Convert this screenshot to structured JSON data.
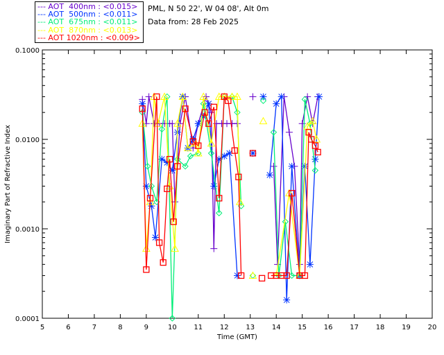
{
  "header": {
    "site": "PML, N 50 22', W 04 08', Alt 0m",
    "date": "Data from: 28 Feb 2025"
  },
  "legend": [
    {
      "label": "AOT  400nm : <0.015>",
      "color": "#6600cc"
    },
    {
      "label": "AOT  500nm : <0.011>",
      "color": "#0033ff"
    },
    {
      "label": "AOT  675nm : <0.011>",
      "color": "#00ee77"
    },
    {
      "label": "AOT  870nm : <0.013>",
      "color": "#ffff00"
    },
    {
      "label": "AOT 1020nm : <0.009>",
      "color": "#ff0000"
    }
  ],
  "chart_data": {
    "type": "line",
    "xlabel": "Time (GMT)",
    "ylabel": "Imaginary Part of Refractive Index",
    "xlim": [
      5,
      20
    ],
    "ylim": [
      0.0001,
      0.1
    ],
    "yscale": "log",
    "xticks": [
      "5",
      "6",
      "7",
      "8",
      "9",
      "10",
      "11",
      "12",
      "13",
      "14",
      "15",
      "16",
      "17",
      "18",
      "19",
      "20"
    ],
    "yticks": [
      "0.0001",
      "0.0010",
      "0.0100",
      "0.1000"
    ],
    "grid": false,
    "legend_position": "top-left",
    "series": [
      {
        "name": "AOT  400nm : <0.015>",
        "color": "#6600cc",
        "marker": "plus",
        "x": [
          8.85,
          9.0,
          9.1,
          9.3,
          9.5,
          9.7,
          9.9,
          10.0,
          10.1,
          10.3,
          10.5,
          10.8,
          11.0,
          11.3,
          11.5,
          11.6,
          11.7,
          11.9,
          12.1,
          12.3,
          12.5,
          null,
          13.1,
          null,
          13.9,
          14.05,
          14.3,
          14.5,
          14.7,
          14.9,
          15.0,
          15.2,
          15.4,
          15.6
        ],
        "y": [
          0.028,
          0.015,
          0.03,
          0.015,
          0.015,
          0.015,
          0.015,
          0.015,
          0.002,
          0.015,
          0.03,
          0.008,
          0.015,
          0.03,
          0.02,
          0.0006,
          0.015,
          0.015,
          0.015,
          0.015,
          0.015,
          null,
          0.03,
          null,
          0.005,
          0.0004,
          0.03,
          0.012,
          0.005,
          0.0004,
          0.015,
          0.03,
          0.015,
          0.03
        ]
      },
      {
        "name": "AOT  500nm : <0.011>",
        "color": "#0033ff",
        "marker": "asterisk",
        "x": [
          8.85,
          9.0,
          9.2,
          9.35,
          9.6,
          9.8,
          10.0,
          10.2,
          10.4,
          10.6,
          10.8,
          11.0,
          11.2,
          11.4,
          11.6,
          11.8,
          12.0,
          12.2,
          12.5,
          null,
          13.1,
          null,
          13.5,
          null,
          13.75,
          14.0,
          14.2,
          14.4,
          14.6,
          14.9,
          15.1,
          15.3,
          15.5,
          15.65
        ],
        "y": [
          0.025,
          0.003,
          0.0018,
          0.0008,
          0.006,
          0.0055,
          0.0045,
          0.012,
          0.03,
          0.008,
          0.01,
          0.015,
          0.018,
          0.025,
          0.003,
          0.006,
          0.0065,
          0.007,
          0.0003,
          null,
          0.007,
          null,
          0.03,
          null,
          0.004,
          0.025,
          0.03,
          0.00016,
          0.005,
          0.0003,
          0.005,
          0.0004,
          0.006,
          0.03
        ]
      },
      {
        "name": "AOT  675nm : <0.011>",
        "color": "#00ee77",
        "marker": "diamond",
        "x": [
          8.85,
          9.05,
          9.2,
          9.4,
          9.6,
          9.8,
          10.0,
          10.2,
          10.5,
          10.7,
          11.0,
          11.2,
          11.5,
          11.8,
          12.0,
          12.3,
          12.5,
          12.65,
          null,
          13.1,
          null,
          13.5,
          null,
          13.9,
          14.1,
          14.35,
          14.6,
          14.9,
          15.1,
          15.3,
          15.5
        ],
        "y": [
          0.02,
          0.005,
          0.003,
          0.002,
          0.013,
          0.03,
          0.0001,
          0.006,
          0.005,
          0.0065,
          0.007,
          0.025,
          0.007,
          0.0015,
          0.03,
          0.03,
          0.02,
          0.0018,
          null,
          0.0003,
          null,
          0.027,
          null,
          0.012,
          0.0003,
          0.0012,
          0.0003,
          0.0003,
          0.028,
          0.015,
          0.0045
        ]
      },
      {
        "name": "AOT  870nm : <0.013>",
        "color": "#ffff00",
        "marker": "triangle",
        "x": [
          8.85,
          9.0,
          9.15,
          9.3,
          9.45,
          9.7,
          9.9,
          10.1,
          10.2,
          10.4,
          10.6,
          10.9,
          11.0,
          11.2,
          11.5,
          11.8,
          12.0,
          12.3,
          12.5,
          12.6,
          null,
          13.1,
          null,
          13.5,
          null,
          14.0,
          14.5,
          14.9,
          15.2,
          15.4,
          15.55
        ],
        "y": [
          0.015,
          0.0006,
          0.002,
          0.03,
          0.015,
          0.03,
          0.003,
          0.0006,
          0.015,
          0.03,
          0.008,
          0.009,
          0.007,
          0.03,
          0.009,
          0.03,
          0.03,
          0.03,
          0.03,
          0.002,
          null,
          0.0003,
          null,
          0.016,
          null,
          0.0003,
          0.0025,
          0.0003,
          0.014,
          0.016,
          0.01
        ]
      },
      {
        "name": "AOT 1020nm : <0.009>",
        "color": "#ff0000",
        "marker": "square",
        "x": [
          8.85,
          9.0,
          9.15,
          9.4,
          9.5,
          9.65,
          9.8,
          9.9,
          10.05,
          10.2,
          10.5,
          10.8,
          11.0,
          11.25,
          11.4,
          11.6,
          11.8,
          12.0,
          12.15,
          12.4,
          12.55,
          12.65,
          null,
          13.1,
          null,
          13.45,
          null,
          13.8,
          14.0,
          14.2,
          14.4,
          14.6,
          14.9,
          15.1,
          15.25,
          15.35,
          15.5,
          15.6
        ],
        "y": [
          0.022,
          0.00035,
          0.0022,
          0.03,
          0.0007,
          0.00042,
          0.0028,
          0.006,
          0.0012,
          0.005,
          0.022,
          0.0095,
          0.0085,
          0.02,
          0.015,
          0.023,
          0.0022,
          0.03,
          0.027,
          0.0075,
          0.0038,
          0.0003,
          null,
          0.007,
          null,
          0.00028,
          null,
          0.0003,
          0.0003,
          0.0003,
          0.0003,
          0.0025,
          0.0003,
          0.0003,
          0.012,
          0.01,
          0.0085,
          0.0072
        ]
      }
    ]
  }
}
